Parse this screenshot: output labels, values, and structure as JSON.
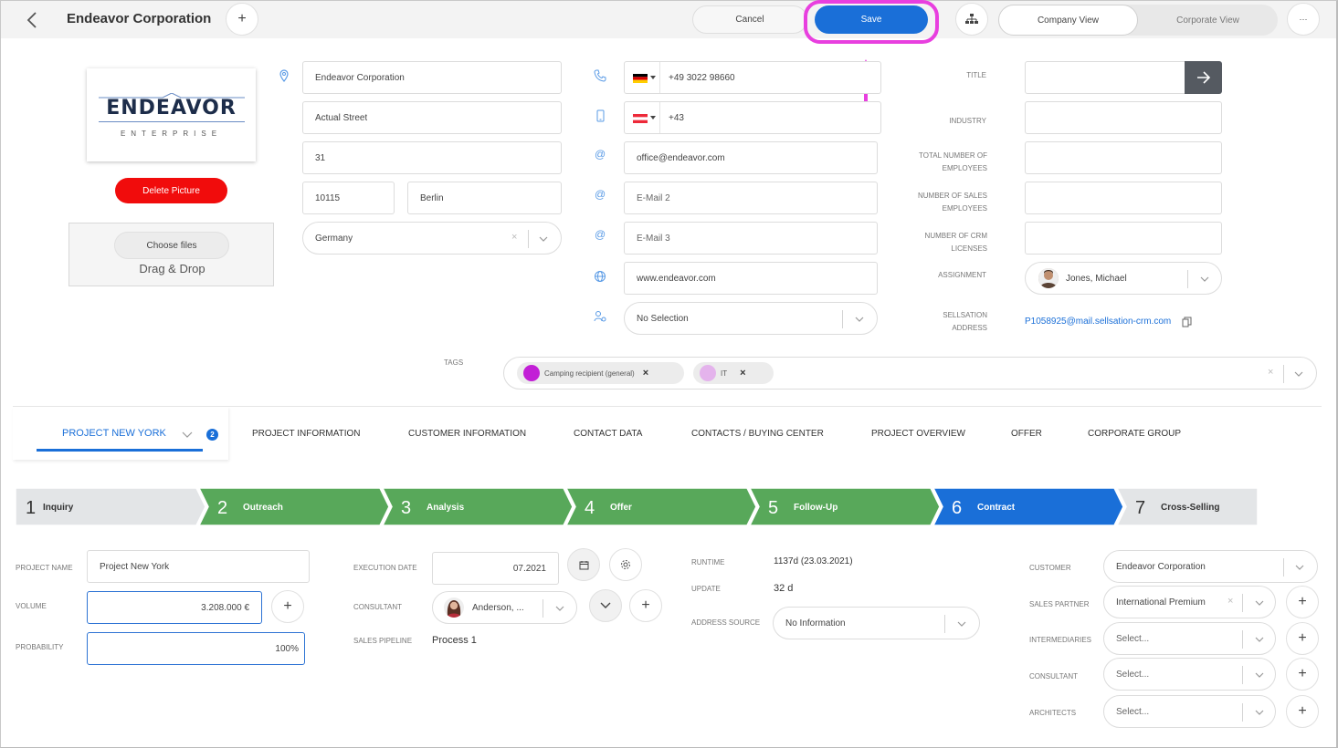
{
  "header": {
    "title": "Endeavor Corporation",
    "cancel_label": "Cancel",
    "save_label": "Save",
    "view_company": "Company View",
    "view_corporate": "Corporate View",
    "more_label": "···",
    "add_label": "+"
  },
  "logo": {
    "main_text": "ENDEAVOR",
    "sub_text": "ENTERPRISE",
    "delete_label": "Delete Picture",
    "choose_files_label": "Choose files",
    "drag_drop_label": "Drag & Drop"
  },
  "address": {
    "company": "Endeavor Corporation",
    "street": "Actual Street",
    "number": "31",
    "zip": "10115",
    "city": "Berlin",
    "country": "Germany"
  },
  "contact": {
    "phone": "+49 3022 98660",
    "mobile": "+43",
    "email1": "office@endeavor.com",
    "email2_placeholder": "E-Mail 2",
    "email3_placeholder": "E-Mail 3",
    "website": "www.endeavor.com",
    "selection": "No Selection"
  },
  "details": {
    "title_label": "TITLE",
    "industry_label": "INDUSTRY",
    "total_employees_label_1": "TOTAL NUMBER OF",
    "total_employees_label_2": "EMPLOYEES",
    "sales_employees_label_1": "NUMBER OF SALES",
    "sales_employees_label_2": "EMPLOYEES",
    "crm_licenses_label_1": "NUMBER OF CRM",
    "crm_licenses_label_2": "LICENSES",
    "assignment_label": "ASSIGNMENT",
    "assignment_value": "Jones, Michael",
    "sellsation_label_1": "SELLSATION",
    "sellsation_label_2": "ADDRESS",
    "sellsation_value": "P1058925@mail.sellsation-crm.com"
  },
  "tags": {
    "label": "TAGS",
    "items": [
      {
        "name": "Camping recipient (general)",
        "color": "#c21fd6"
      },
      {
        "name": "IT",
        "color": "#e4b3ec"
      }
    ]
  },
  "tabs": {
    "active": "PROJECT NEW YORK",
    "active_badge": "2",
    "items": [
      "PROJECT INFORMATION",
      "CUSTOMER INFORMATION",
      "CONTACT DATA",
      "CONTACTS / BUYING CENTER",
      "PROJECT OVERVIEW",
      "OFFER",
      "CORPORATE GROUP"
    ]
  },
  "pipeline": {
    "stages": [
      {
        "num": "1",
        "label": "Inquiry",
        "state": "pending"
      },
      {
        "num": "2",
        "label": "Outreach",
        "state": "done"
      },
      {
        "num": "3",
        "label": "Analysis",
        "state": "done"
      },
      {
        "num": "4",
        "label": "Offer",
        "state": "done"
      },
      {
        "num": "5",
        "label": "Follow-Up",
        "state": "done"
      },
      {
        "num": "6",
        "label": "Contract",
        "state": "current"
      },
      {
        "num": "7",
        "label": "Cross-Selling",
        "state": "pending"
      }
    ],
    "colors": {
      "done": "#58a85a",
      "current": "#1a6fd8",
      "pending": "#e3e5e7"
    }
  },
  "project": {
    "name_label": "PROJECT NAME",
    "name_value": "Project New York",
    "volume_label": "VOLUME",
    "volume_value": "3.208.000 €",
    "probability_label": "PROBABILITY",
    "probability_value": "100%",
    "execution_label": "EXECUTION DATE",
    "execution_value": "07.2021",
    "consultant_label": "CONSULTANT",
    "consultant_value": "Anderson, ...",
    "pipeline_label": "SALES PIPELINE",
    "pipeline_value": "Process 1",
    "runtime_label": "RUNTIME",
    "runtime_value": "1137d (23.03.2021)",
    "update_label": "UPDATE",
    "update_value": "32 d",
    "address_source_label": "ADDRESS SOURCE",
    "address_source_value": "No Information",
    "customer_label": "CUSTOMER",
    "customer_value": "Endeavor Corporation",
    "sales_partner_label": "SALES PARTNER",
    "sales_partner_value": "International Premium",
    "intermediaries_label": "INTERMEDIARIES",
    "intermediaries_value": "Select...",
    "consultant2_label": "CONSULTANT",
    "consultant2_value": "Select...",
    "architects_label": "ARCHITECTS",
    "architects_value": "Select..."
  }
}
